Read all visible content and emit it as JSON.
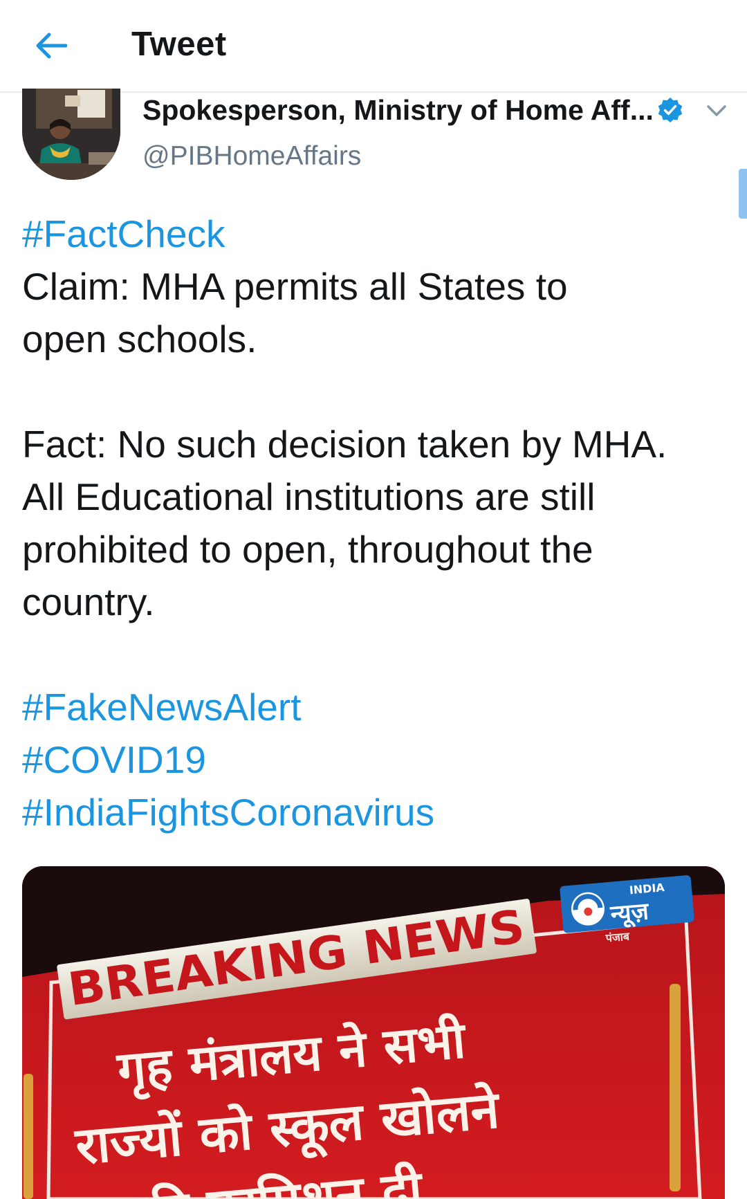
{
  "header": {
    "title": "Tweet"
  },
  "author": {
    "name": "Spokesperson, Ministry of Home Aff...",
    "handle": "@PIBHomeAffairs"
  },
  "tweet": {
    "hashtag_1": "#FactCheck",
    "claim_line_1": "Claim: MHA permits all States to",
    "claim_line_2": "open schools.",
    "fact_line_1": "Fact: No such decision taken by MHA.",
    "fact_line_2": "All Educational institutions are still",
    "fact_line_3": "prohibited to open, throughout the",
    "fact_line_4": "country.",
    "hashtag_2": "#FakeNewsAlert",
    "hashtag_3": "#COVID19",
    "hashtag_4": "#IndiaFightsCoronavirus"
  },
  "media": {
    "banner_text": "BREAKING NEWS",
    "logo_top": "INDIA",
    "logo_main": "न्यूज़",
    "logo_sub": "पंजाब",
    "hindi_line_1": "गृह मंत्रालय ने सभी",
    "hindi_line_2": "राज्यों को स्कूल खोलने",
    "hindi_line_3": "की परमिशन दी"
  },
  "colors": {
    "link_blue": "#1b95e0",
    "text_primary": "#14171a",
    "text_secondary": "#657786",
    "breaking_red": "#c4161b"
  },
  "icons": {
    "back": "arrow-left-icon",
    "verified": "verified-badge-icon",
    "caret": "chevron-down-icon"
  }
}
